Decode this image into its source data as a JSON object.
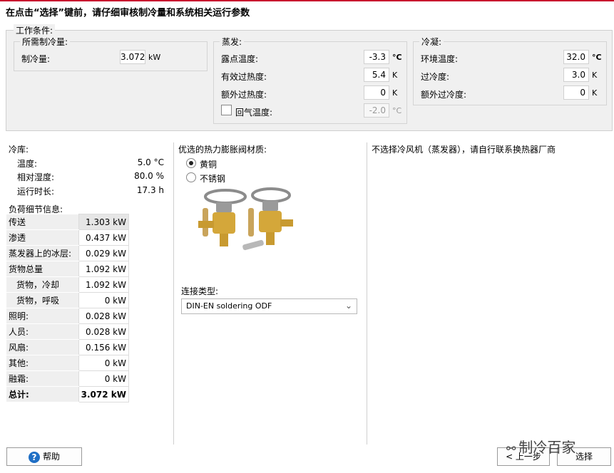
{
  "title": "在点击“选择”键前，请仔细审核制冷量和系统相关运行参数",
  "work_conditions": {
    "legend": "工作条件:",
    "capacity_group": {
      "legend": "所需制冷量:",
      "label": "制冷量:",
      "value": "3.072",
      "unit": "kW"
    },
    "evap_group": {
      "legend": "蒸发:",
      "dew_label": "露点温度:",
      "dew_value": "-3.3",
      "dew_unit": "°C",
      "superheat_label": "有效过热度:",
      "superheat_value": "5.4",
      "superheat_unit": "K",
      "extra_superheat_label": "额外过热度:",
      "extra_superheat_value": "0",
      "extra_superheat_unit": "K",
      "return_gas_label": "回气温度:",
      "return_gas_value": "-2.0",
      "return_gas_unit": "°C"
    },
    "cond_group": {
      "legend": "冷凝:",
      "ambient_label": "环境温度:",
      "ambient_value": "32.0",
      "ambient_unit": "°C",
      "subcool_label": "过冷度:",
      "subcool_value": "3.0",
      "subcool_unit": "K",
      "extra_subcool_label": "额外过冷度:",
      "extra_subcool_value": "0",
      "extra_subcool_unit": "K"
    }
  },
  "cold_room": {
    "heading": "冷库:",
    "temp_label": "温度:",
    "temp_value": "5.0 °C",
    "humidity_label": "相对湿度:",
    "humidity_value": "80.0 %",
    "runtime_label": "运行时长:",
    "runtime_value": "17.3 h"
  },
  "load": {
    "heading": "负荷细节信息:",
    "rows": [
      {
        "name": "传送",
        "value": "1.303 kW"
      },
      {
        "name": "渗透",
        "value": "0.437 kW"
      },
      {
        "name": "蒸发器上的冰层:",
        "value": "0.029 kW"
      },
      {
        "name": "货物总量",
        "value": "1.092 kW"
      },
      {
        "name": "货物，冷却",
        "value": "1.092 kW"
      },
      {
        "name": "货物，呼吸",
        "value": "0 kW"
      },
      {
        "name": "照明:",
        "value": "0.028 kW"
      },
      {
        "name": "人员:",
        "value": "0.028 kW"
      },
      {
        "name": "风扇:",
        "value": "0.156 kW"
      },
      {
        "name": "其他:",
        "value": "0 kW"
      },
      {
        "name": "融霜:",
        "value": "0 kW"
      },
      {
        "name": "总计:",
        "value": "3.072 kW"
      }
    ]
  },
  "valve": {
    "heading": "优选的热力膨胀阀材质:",
    "options": [
      "黄铜",
      "不锈钢"
    ],
    "selected": "黄铜",
    "connection_label": "连接类型:",
    "connection_value": "DIN-EN soldering ODF"
  },
  "note": "不选择冷风机（蒸发器），请自行联系换热器厂商",
  "buttons": {
    "help": "帮助",
    "back": "< 上一步",
    "select": "选择"
  },
  "watermark": "制冷百家",
  "colors": {
    "accent": "#c8102e",
    "help_icon": "#1f6fc5"
  }
}
